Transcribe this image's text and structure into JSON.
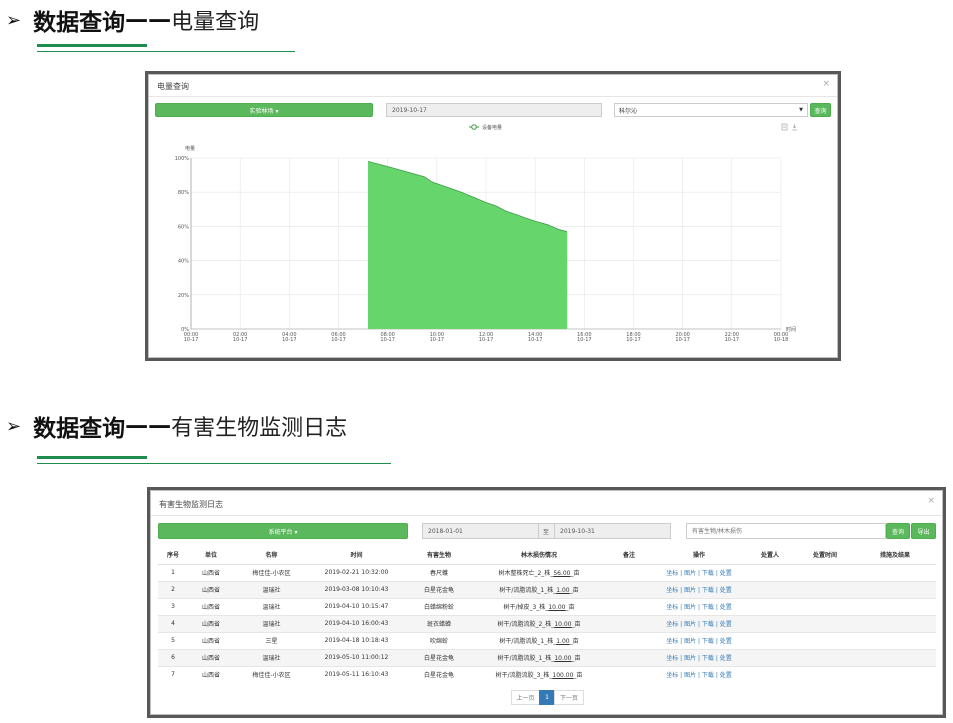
{
  "section1": {
    "arrow": "➢",
    "bold": "数据查询",
    "dash": "——",
    "rest": "电量查询"
  },
  "section2": {
    "arrow": "➢",
    "bold": "数据查询",
    "dash": "——",
    "rest": "有害生物监测日志"
  },
  "power_panel": {
    "title": "电量查询",
    "close": "×",
    "device_button": "实验林场 ▾",
    "date": "2019-10-17",
    "select_value": "科尔沁",
    "query_button": "查询"
  },
  "log_panel": {
    "title": "有害生物监测日志",
    "close": "×",
    "platform_button": "系统平台 ▾",
    "date_from": "2018-01-01",
    "date_to_label": "至",
    "date_to": "2019-10-31",
    "search_placeholder": "有害生物/林木损伤",
    "query_button": "查询",
    "export_button": "导出",
    "columns": [
      "序号",
      "单位",
      "名称",
      "时间",
      "有害生物",
      "林木损伤情况",
      "备注",
      "操作",
      "处置人",
      "处置时间",
      "措施及结果"
    ],
    "rows": [
      {
        "no": "1",
        "unit": "山西省",
        "name": "梅佳佳-小农区",
        "time": "2019-02-21 10:32:00",
        "pest": "春尺蠖",
        "damage_pre": "树木整株死亡_2_株_",
        "damage_val": "56.00",
        "damage_unit": "_亩"
      },
      {
        "no": "2",
        "unit": "山西省",
        "name": "温瑞社",
        "time": "2019-03-08 10:10:43",
        "pest": "白星花金龟",
        "damage_pre": "树干/流脂流胶_1_株_",
        "damage_val": "1.00",
        "damage_unit": "_亩"
      },
      {
        "no": "3",
        "unit": "山西省",
        "name": "温瑞社",
        "time": "2019-04-10 10:15:47",
        "pest": "白蜡绵粉蚧",
        "damage_pre": "树干/掉皮_3_株_",
        "damage_val": "10.00",
        "damage_unit": "_亩"
      },
      {
        "no": "4",
        "unit": "山西省",
        "name": "温瑞社",
        "time": "2019-04-10 16:00:43",
        "pest": "斑衣蜡蝉",
        "damage_pre": "树干/流脂流胶_2_株_",
        "damage_val": "10.00",
        "damage_unit": "_亩"
      },
      {
        "no": "5",
        "unit": "山西省",
        "name": "三星",
        "time": "2019-04-18 10:18:43",
        "pest": "吹绵蚧",
        "damage_pre": "树干/流脂流胶_1_株_",
        "damage_val": "1.00",
        "damage_unit": "_亩"
      },
      {
        "no": "6",
        "unit": "山西省",
        "name": "温瑞社",
        "time": "2019-05-10 11:00:12",
        "pest": "白星花金龟",
        "damage_pre": "树干/流脂流胶_1_株_",
        "damage_val": "10.00",
        "damage_unit": "_亩"
      },
      {
        "no": "7",
        "unit": "山西省",
        "name": "梅佳佳-小农区",
        "time": "2019-05-11 16:10:43",
        "pest": "白星花金龟",
        "damage_pre": "树干/流脂流胶_3_株_",
        "damage_val": "100.00",
        "damage_unit": "_亩"
      }
    ],
    "ops": [
      "坐标",
      "图片",
      "下载",
      "处置"
    ],
    "pager": {
      "prev": "上一页",
      "page": "1",
      "next": "下一页"
    }
  },
  "colors": {
    "accent_green": "#5cb85c",
    "area_fill": "#66d56b",
    "area_line": "#3f9c48",
    "link_blue": "#337ab7",
    "heading_underline": "#1e8c4e"
  },
  "icons": [
    "document-icon",
    "download-icon",
    "close-icon",
    "chevron-down-icon"
  ],
  "chart_data": {
    "type": "area",
    "legend": [
      "设备电量"
    ],
    "legend_position": "top-center",
    "ylabel": "电量",
    "xlabel": "时间",
    "yticks": [
      "0%",
      "20%",
      "40%",
      "60%",
      "80%",
      "100%"
    ],
    "ylim": [
      0,
      100
    ],
    "xticks": [
      "00:00|10-17",
      "02:00|10-17",
      "04:00|10-17",
      "06:00|10-17",
      "08:00|10-17",
      "10:00|10-17",
      "12:00|10-17",
      "14:00|10-17",
      "16:00|10-17",
      "18:00|10-17",
      "20:00|10-17",
      "22:00|10-17",
      "00:00|10-18"
    ],
    "xlim_hours": [
      0,
      24
    ],
    "grid": true,
    "series": [
      {
        "name": "设备电量",
        "x_hours": [
          7.2,
          7.6,
          8.0,
          8.5,
          9.0,
          9.5,
          9.8,
          10.2,
          10.5,
          11.0,
          11.5,
          12.0,
          12.4,
          12.8,
          13.2,
          13.6,
          14.0,
          14.5,
          15.0,
          15.3
        ],
        "values": [
          98,
          96.5,
          95,
          93,
          91,
          89,
          86,
          84,
          82.5,
          80,
          77,
          74,
          72,
          69,
          67,
          65,
          63,
          61,
          58,
          57
        ]
      }
    ]
  }
}
